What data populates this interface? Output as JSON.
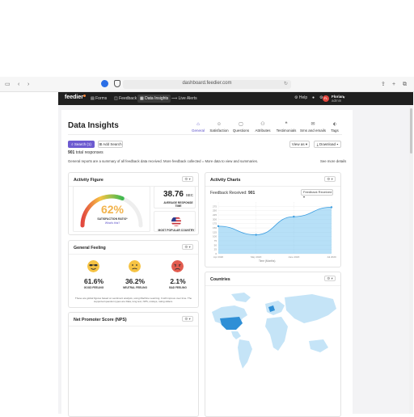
{
  "browser": {
    "url": "dashboard.feedier.com"
  },
  "nav": {
    "logo": "feedier",
    "items": [
      {
        "label": "Forms",
        "icon": "forms-icon"
      },
      {
        "label": "Feedback",
        "icon": "feedback-icon"
      },
      {
        "label": "Data Insights",
        "icon": "data-insights-icon"
      },
      {
        "label": "Live Alerts",
        "icon": "live-alerts-icon"
      }
    ],
    "help_label": "Help",
    "user": {
      "initials": "FL",
      "name": "Florian",
      "role": "admin"
    }
  },
  "page": {
    "title": "Data Insights",
    "tabs": [
      {
        "label": "General",
        "icon": "home-icon",
        "active": true
      },
      {
        "label": "Satisfaction",
        "icon": "smile-icon"
      },
      {
        "label": "Questions",
        "icon": "chat-icon"
      },
      {
        "label": "Attributes",
        "icon": "users-icon"
      },
      {
        "label": "Testimonials",
        "icon": "quote-icon"
      },
      {
        "label": "Sms and emails",
        "icon": "mail-icon"
      },
      {
        "label": "Tags",
        "icon": "tag-icon"
      }
    ],
    "search_button": "Search (1)",
    "add_search_button": "Add Search",
    "view_as_button": "View as",
    "download_button": "Download",
    "total_count": "901",
    "total_label": "total responses",
    "description": "General reports are a summary of all feedback data received. More feedback collected = More data to view and summaries.",
    "see_more": "See more details"
  },
  "activity_figure": {
    "title": "Activity Figure",
    "satisfaction_pct": "62%",
    "satisfaction_value": 0.62,
    "satisfaction_label": "SATISFACTION RATIO*",
    "satisfaction_link": "What's this?",
    "avg_response_value": "38.76",
    "avg_response_unit": "SEC",
    "avg_response_label": "AVERAGE RESPONSE TIME",
    "country_label": "MOST POPULAR COUNTRY"
  },
  "general_feeling": {
    "title": "General Feeling",
    "items": [
      {
        "pct": "61.6%",
        "label": "GOOD FEELING",
        "color": "#f6c343",
        "face": "cool-face-icon"
      },
      {
        "pct": "36.2%",
        "label": "NEUTRAL FEELING",
        "color": "#f6c343",
        "face": "neutral-face-icon"
      },
      {
        "pct": "2.1%",
        "label": "BAD FEELING",
        "color": "#e25c4f",
        "face": "bad-face-icon"
      }
    ],
    "note": "These are global figures based on sentiment analysis, using Machine Learning. It will improve over time. The supported question types are Data, long text, NPS, smileys, rating sliders."
  },
  "nps": {
    "title": "Net Promoter Score (NPS)"
  },
  "activity_charts": {
    "title": "Activity Charts",
    "legend_label": "Feedback Received:",
    "legend_value": "901",
    "select_label": "Feedback Received",
    "axis_title": "Time (Months)"
  },
  "countries": {
    "title": "Countries"
  },
  "chart_data": {
    "type": "area",
    "x": [
      "Apr 2020",
      "May 2020",
      "June 2020",
      "Jul 2020"
    ],
    "series": [
      {
        "values": [
          160,
          110,
          215,
          270
        ]
      }
    ],
    "ylim": [
      0,
      300
    ],
    "yticks": [
      0,
      25,
      50,
      75,
      100,
      125,
      150,
      175,
      200,
      225,
      250,
      275
    ],
    "xlabel": "Time (Months)",
    "ylabel": "",
    "grid": true,
    "color": "#7cc6f0"
  },
  "colors": {
    "accent": "#6d5bd0",
    "nav_bg": "#1f1f1f",
    "gauge": "#f2b34c"
  }
}
